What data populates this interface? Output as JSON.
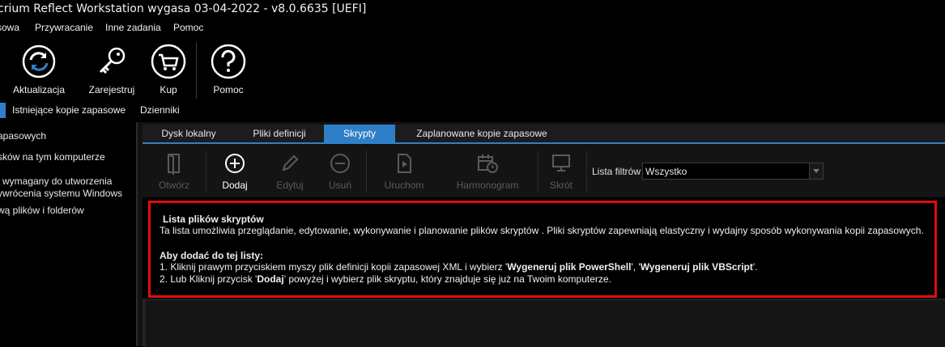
{
  "window": {
    "title": "crium Reflect Workstation wygasa 03-04-2022 - v8.0.6635  [UEFI]"
  },
  "menu": [
    {
      "label": "sowa"
    },
    {
      "label": "Przywracanie"
    },
    {
      "label": "Inne zadania"
    },
    {
      "label": "Pomoc"
    }
  ],
  "toolbar": [
    {
      "label": "Aktualizacja",
      "icon": "update-icon"
    },
    {
      "label": "Zarejestruj",
      "icon": "key-icon"
    },
    {
      "label": "Kup",
      "icon": "cart-icon"
    },
    {
      "label": "Pomoc",
      "icon": "help-icon"
    }
  ],
  "subtabs": [
    {
      "label": "Istniejące kopie zapasowe"
    },
    {
      "label": "Dzienniki"
    }
  ],
  "left_panel": {
    "items": [
      {
        "label": "apasowych"
      },
      {
        "label": "sków na tym komputerze"
      },
      {
        "label": "i wymagany do utworzenia"
      },
      {
        "label": "ywrócenia systemu Windows"
      },
      {
        "label": "wą plików i folderów"
      }
    ]
  },
  "tabs": [
    {
      "label": "Dysk lokalny"
    },
    {
      "label": "Pliki definicji"
    },
    {
      "label": "Skrypty"
    },
    {
      "label": "Zaplanowane kopie zapasowe"
    }
  ],
  "active_tab": "Skrypty",
  "actions": [
    {
      "label": "Otwórz",
      "icon": "open-document-icon",
      "enabled": false
    },
    {
      "label": "Dodaj",
      "icon": "add-circle-icon",
      "enabled": true
    },
    {
      "label": "Edytuj",
      "icon": "pencil-icon",
      "enabled": false
    },
    {
      "label": "Usuń",
      "icon": "remove-circle-icon",
      "enabled": false
    },
    {
      "label": "Uruchom",
      "icon": "run-script-icon",
      "enabled": false
    },
    {
      "label": "Harmonogram",
      "icon": "calendar-clock-icon",
      "enabled": false
    },
    {
      "label": "Skrót",
      "icon": "desktop-shortcut-icon",
      "enabled": false
    }
  ],
  "filter": {
    "label": "Lista filtrów",
    "value": "Wszystko"
  },
  "info": {
    "title": "Lista plików skryptów",
    "description": "Ta lista umożliwia przeglądanie, edytowanie, wykonywanie i planowanie plików skryptów . Pliki skryptów zapewniają elastyczny i wydajny sposób wykonywania kopii zapasowych.",
    "howto_title": "Aby dodać do tej listy:",
    "step1_prefix": "1. Kliknij prawym przyciskiem myszy plik definicji kopii zapasowej XML i wybierz '",
    "step1_bold1": "Wygeneruj plik PowerShell",
    "step1_mid": "', '",
    "step1_bold2": "Wygeneruj plik VBScript",
    "step1_suffix": "'.",
    "step2_prefix": "2. Lub Kliknij przycisk '",
    "step2_bold": "Dodaj",
    "step2_suffix": "' powyżej i wybierz plik skryptu, który znajduje się już na Twoim komputerze."
  },
  "colors": {
    "accent": "#2f7fc8",
    "highlight": "#e10b0b"
  }
}
